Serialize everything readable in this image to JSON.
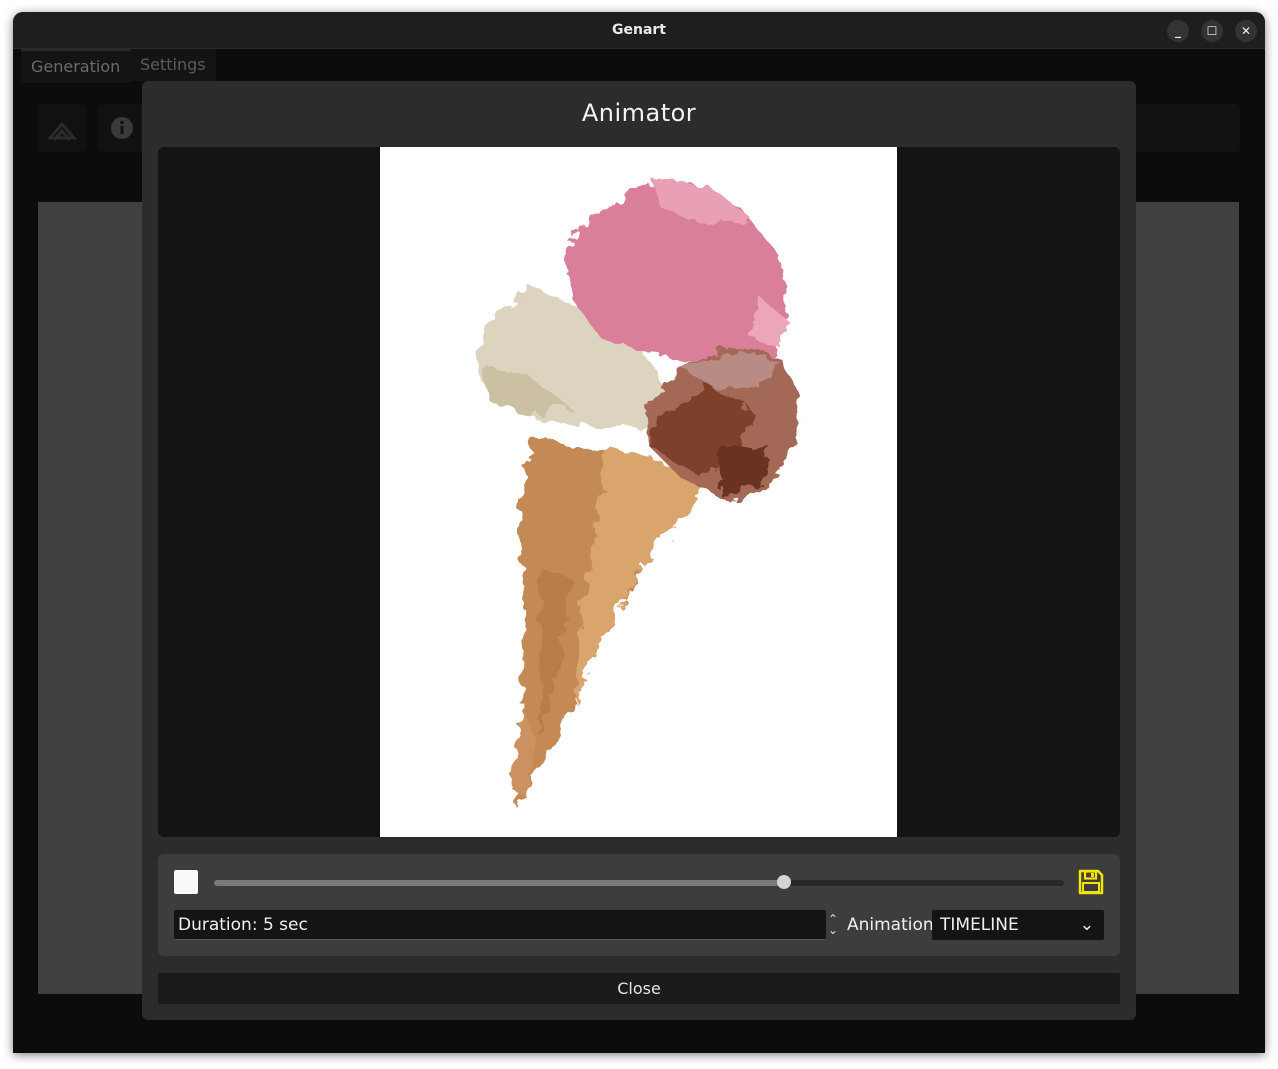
{
  "window": {
    "title": "Genart"
  },
  "window_controls": {
    "minimize": "_",
    "maximize": "☐",
    "close": "✕"
  },
  "tabs": [
    {
      "label": "Generation",
      "active": true
    },
    {
      "label": "Settings",
      "active": false
    }
  ],
  "modal": {
    "title": "Animator",
    "playback": {
      "progress": 0.67
    },
    "duration_text": "Duration: 5 sec",
    "animation_label": "Animation",
    "animation_value": "TIMELINE",
    "close_label": "Close"
  },
  "colors": {
    "accent_save": "#f5e400",
    "modal_bg": "#2c2c2c",
    "panel_bg": "#3d3d3d"
  }
}
